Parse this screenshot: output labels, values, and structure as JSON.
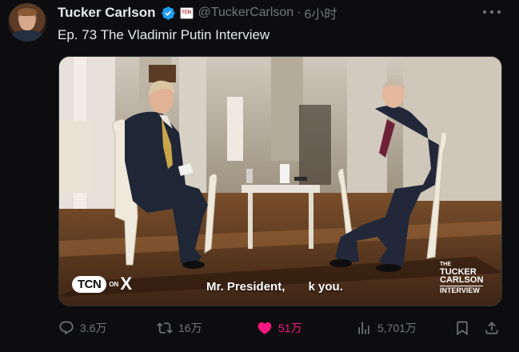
{
  "post": {
    "author_name": "Tucker Carlson",
    "handle": "@TuckerCarlson",
    "separator": "·",
    "timestamp": "6小时",
    "org_badge_text": "TCN",
    "text": "Ep. 73  The Vladimir Putin Interview"
  },
  "media": {
    "channel_logo": "TCN",
    "channel_on": "ON",
    "channel_x": "X",
    "subtitle": "Mr. President,       k you.",
    "show_logo": [
      "THE",
      "TUCKER",
      "CARLSON",
      "INTERVIEW"
    ]
  },
  "actions": {
    "replies": "3.6万",
    "reposts": "16万",
    "likes": "51万",
    "views": "5,701万"
  },
  "icons": {
    "verified": "verified-badge-icon",
    "more": "more-icon",
    "reply": "reply-icon",
    "repost": "repost-icon",
    "like": "heart-icon",
    "views": "analytics-icon",
    "bookmark": "bookmark-icon",
    "share": "share-icon"
  },
  "colors": {
    "like_active": "#f91880",
    "verified_blue": "#1d9bf0",
    "muted": "#71767b"
  }
}
